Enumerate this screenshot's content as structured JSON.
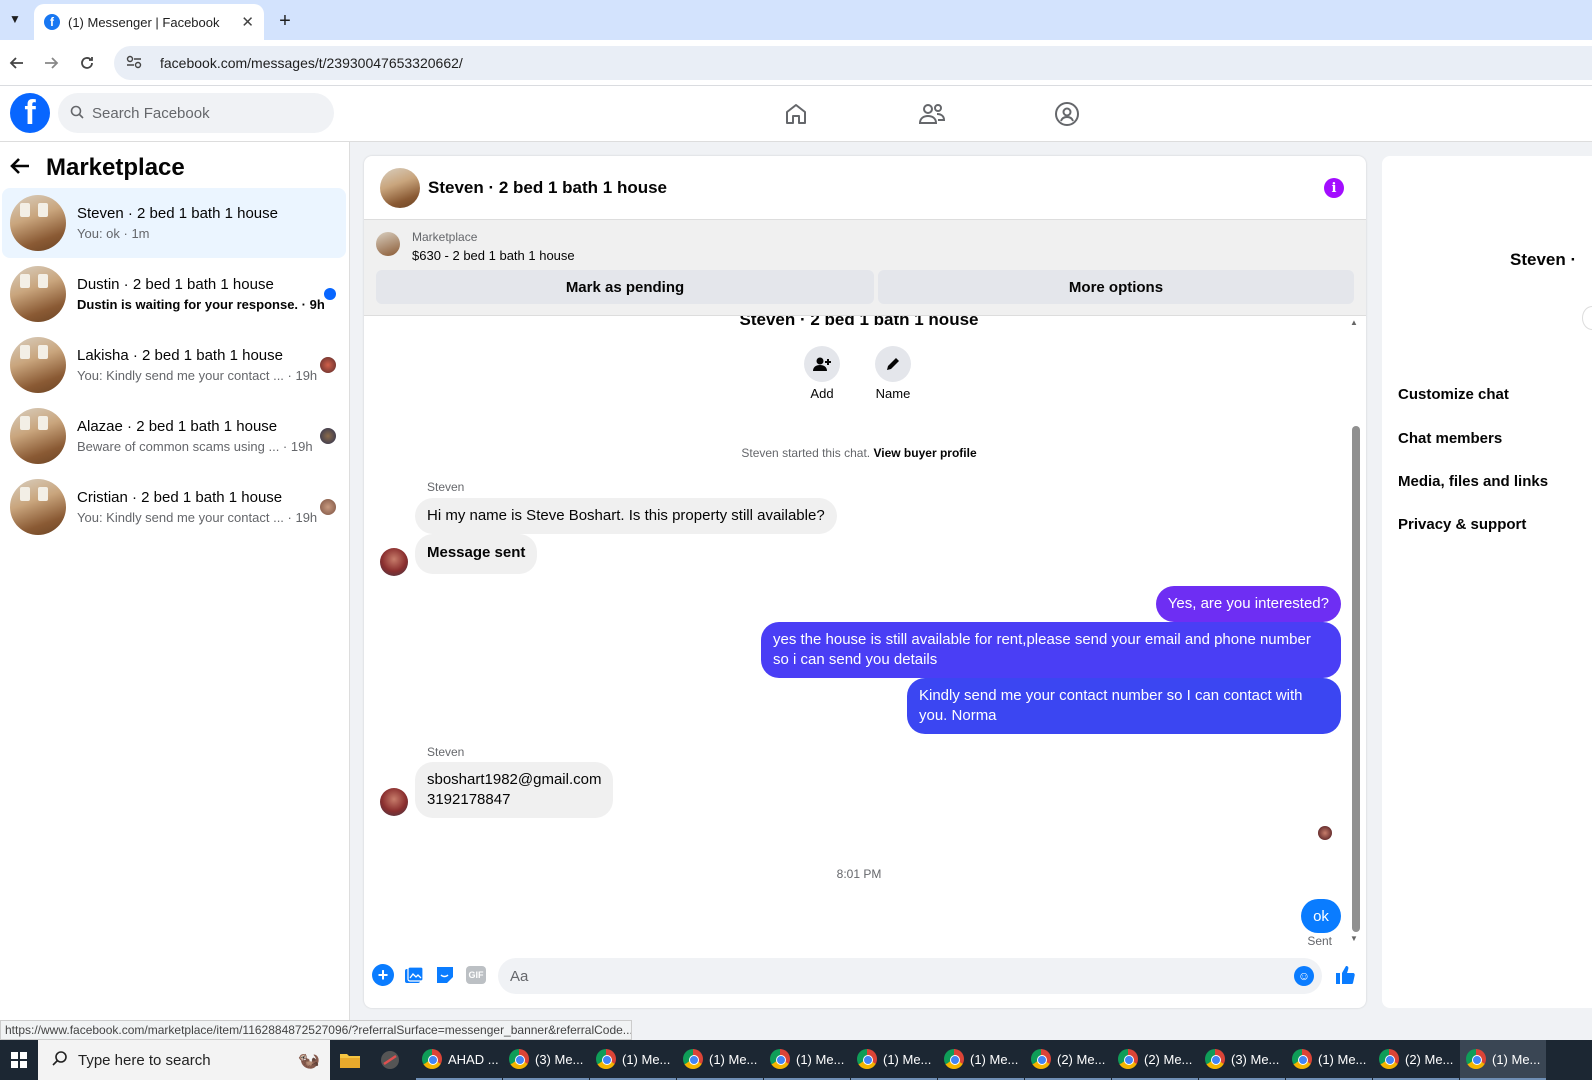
{
  "browser": {
    "tab_title": "(1) Messenger | Facebook",
    "tab_favicon": "facebook-icon",
    "close_glyph": "✕",
    "new_tab_glyph": "+",
    "url": "facebook.com/messages/t/23930047653320662/"
  },
  "fb": {
    "logo": "f",
    "search_placeholder": "Search Facebook",
    "nav_icons": [
      "home-icon",
      "friends-icon",
      "groups-icon"
    ]
  },
  "sidebar": {
    "title": "Marketplace",
    "back_glyph": "🡐",
    "conversations": [
      {
        "name": "Steven · 2 bed 1 bath 1 house",
        "preview": "You: ok · 1m",
        "active": true
      },
      {
        "name": "Dustin · 2 bed 1 bath 1 house",
        "preview": "Dustin is waiting for your response. · 9h",
        "unread": true
      },
      {
        "name": "Lakisha · 2 bed 1 bath 1 house",
        "preview": "You: Kindly send me your contact ... · 19h"
      },
      {
        "name": "Alazae · 2 bed 1 bath 1 house",
        "preview": "Beware of common scams using ... · 19h"
      },
      {
        "name": "Cristian · 2 bed 1 bath 1 house",
        "preview": "You: Kindly send me your contact ... · 19h"
      }
    ]
  },
  "chat": {
    "header_name": "Steven · 2 bed 1 bath 1 house",
    "info_glyph": "i",
    "banner": {
      "label": "Marketplace",
      "listing": "$630 - 2 bed 1 bath 1 house",
      "mark_pending": "Mark as pending",
      "more_options": "More options"
    },
    "thread_title": "Steven · 2 bed 1 bath 1 house",
    "actions": {
      "add": "Add",
      "name": "Name"
    },
    "started_text": "Steven started this chat.",
    "view_profile": "View buyer profile",
    "sender_name": "Steven",
    "msg_in_1": "Hi my name is Steve Boshart. Is this property still available?",
    "msg_in_2": "Message sent",
    "msg_out_1": "Yes, are you interested?",
    "msg_out_2": "yes the house is still available for rent,please send your email and phone number so i can send you details",
    "msg_out_3": "Kindly send me your contact number so I can contact with you. Norma",
    "sender_name_2": "Steven",
    "msg_in_3_line1": "sboshart1982@gmail.com",
    "msg_in_3_line2": "3192178847",
    "timestamp": "8:01 PM",
    "msg_out_4": "ok",
    "sent_label": "Sent",
    "input_placeholder": "Aa"
  },
  "right_panel": {
    "name": "Steven ·",
    "items": [
      "Customize chat",
      "Chat members",
      "Media, files and links",
      "Privacy & support"
    ]
  },
  "status_url": "https://www.facebook.com/marketplace/item/1162884872527096/?referralSurface=messenger_banner&referralCode...",
  "taskbar": {
    "search_placeholder": "Type here to search",
    "apps": [
      "AHAD ...",
      "(3) Me...",
      "(1) Me...",
      "(1) Me...",
      "(1) Me...",
      "(1) Me...",
      "(1) Me...",
      "(2) Me...",
      "(2) Me...",
      "(3) Me...",
      "(1) Me...",
      "(2) Me...",
      "(1) Me..."
    ]
  },
  "colors": {
    "fb_blue": "#0866ff",
    "bubble_purple": "#6e2ef3",
    "bubble_blue": "#0a7cff",
    "info_purple": "#a30dff"
  }
}
